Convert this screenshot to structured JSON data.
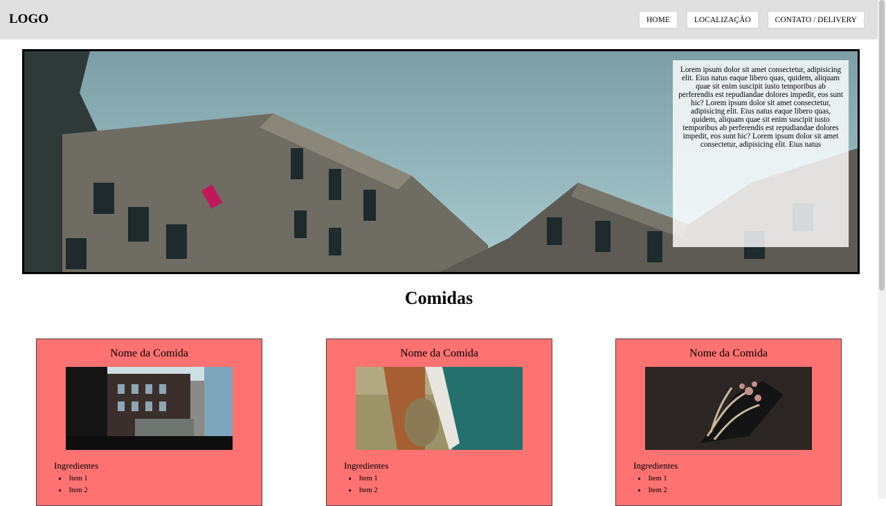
{
  "header": {
    "logo": "LOGO",
    "nav": [
      "HOME",
      "LOCALIZAÇÃO",
      "CONTATO / DELIVERY"
    ]
  },
  "hero": {
    "text": "Lorem ipsum dolor sit amet consectetur, adipisicing elit. Eius natus eaque libero quas, quidem, aliquam quae sit enim suscipit iusto temporibus ab perferendis est repudiandae dolores impedit, eos sunt hic? Lorem ipsum dolor sit amet consectetur, adipisicing elit. Eius natus eaque libero quas, quidem, aliquam quae sit enim suscipit iusto temporibus ab perferendis est repudiandae dolores impedit, eos sunt hic? Lorem ipsum dolor sit amet consectetur, adipisicing elit. Eius natus"
  },
  "section": {
    "title": "Comidas"
  },
  "cards": [
    {
      "title": "Nome da Comida",
      "subtitle": "Ingredientes",
      "items": [
        "Item 1",
        "Item 2"
      ]
    },
    {
      "title": "Nome da Comida",
      "subtitle": "Ingredientes",
      "items": [
        "Item 1",
        "Item 2"
      ]
    },
    {
      "title": "Nome da Comida",
      "subtitle": "Ingredientes",
      "items": [
        "Item 1",
        "Item 2"
      ]
    }
  ],
  "colors": {
    "header_bg": "#e0e0e0",
    "card_bg": "#ff7272"
  }
}
